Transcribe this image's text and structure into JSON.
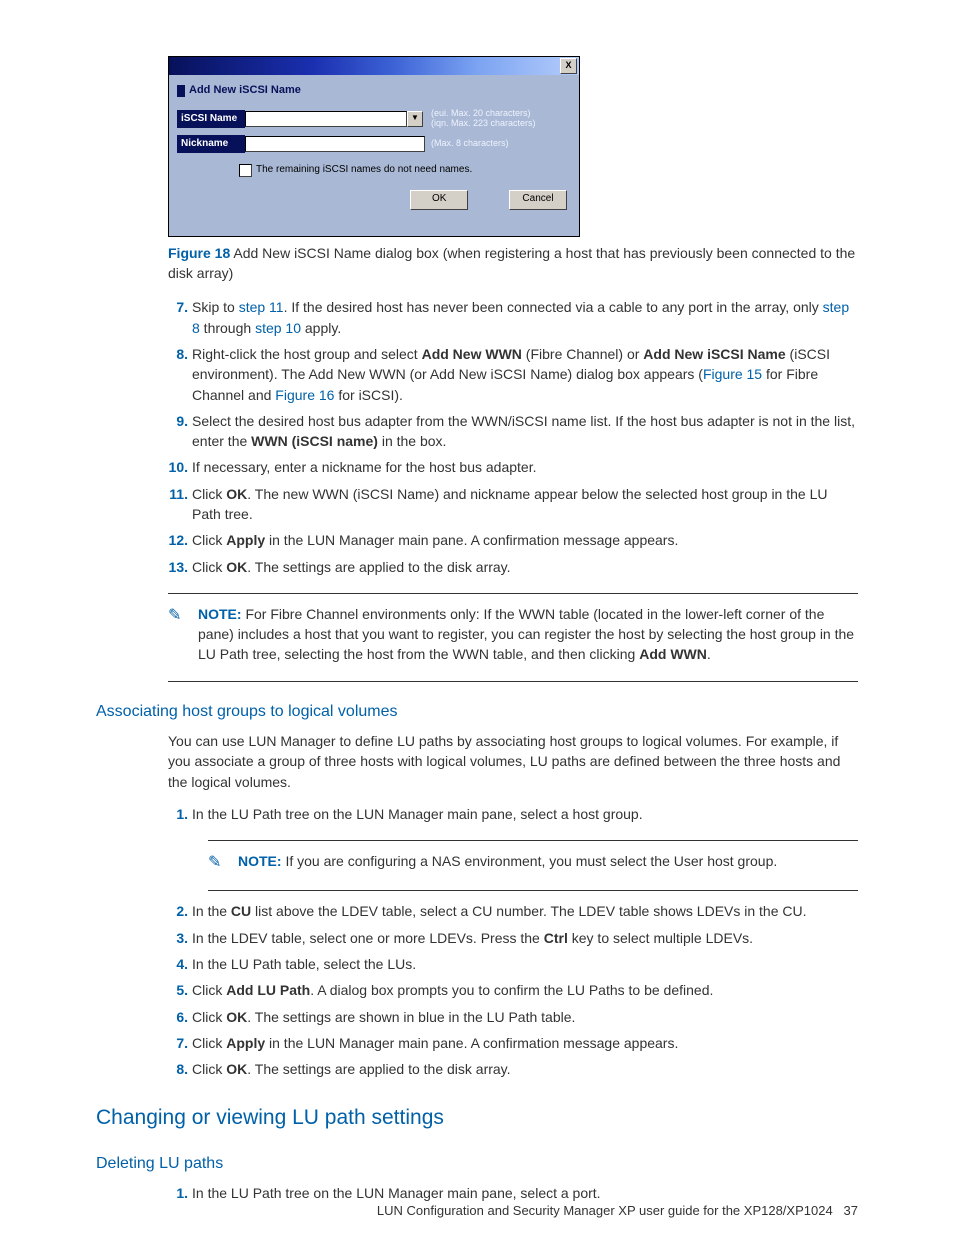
{
  "dialog": {
    "heading": "Add New iSCSI Name",
    "row1_label": "iSCSI Name",
    "row1_hint1": "(eui. Max. 20 characters)",
    "row1_hint2": "(iqn. Max. 223 characters)",
    "row2_label": "Nickname",
    "row2_hint": "(Max. 8 characters)",
    "checkbox": "The remaining iSCSI names do not need names.",
    "ok": "OK",
    "cancel": "Cancel",
    "close": "X",
    "dd": "▼"
  },
  "figure": {
    "num": "Figure 18",
    "caption": " Add New iSCSI Name dialog box (when registering a host that has previously been connected to the disk array)"
  },
  "steps_a": [
    {
      "n": "7.",
      "parts": [
        {
          "t": "Skip to "
        },
        {
          "t": "step 11",
          "l": 1
        },
        {
          "t": ". If the desired host has never been connected via a cable to any port in the array, only "
        },
        {
          "t": "step 8",
          "l": 1
        },
        {
          "t": " through "
        },
        {
          "t": "step 10",
          "l": 1
        },
        {
          "t": " apply."
        }
      ]
    },
    {
      "n": "8.",
      "parts": [
        {
          "t": "Right-click the host group and select "
        },
        {
          "t": "Add New WWN",
          "b": 1
        },
        {
          "t": " (Fibre Channel) or "
        },
        {
          "t": "Add New iSCSI Name",
          "b": 1
        },
        {
          "t": " (iSCSI environment). The Add New WWN (or Add New iSCSI Name) dialog box appears ("
        },
        {
          "t": "Figure 15",
          "l": 1
        },
        {
          "t": " for Fibre Channel and "
        },
        {
          "t": "Figure 16",
          "l": 1
        },
        {
          "t": " for iSCSI)."
        }
      ]
    },
    {
      "n": "9.",
      "parts": [
        {
          "t": "Select the desired host bus adapter from the WWN/iSCSI name list. If the host bus adapter is not in the list, enter the "
        },
        {
          "t": "WWN (iSCSI name)",
          "b": 1
        },
        {
          "t": " in the box."
        }
      ]
    },
    {
      "n": "10.",
      "parts": [
        {
          "t": "If necessary, enter a nickname for the host bus adapter."
        }
      ]
    },
    {
      "n": "11.",
      "parts": [
        {
          "t": "Click "
        },
        {
          "t": "OK",
          "b": 1
        },
        {
          "t": ". The new WWN (iSCSI Name) and nickname appear below the selected host group in the LU Path tree."
        }
      ]
    },
    {
      "n": "12.",
      "parts": [
        {
          "t": "Click "
        },
        {
          "t": "Apply",
          "b": 1
        },
        {
          "t": " in the LUN Manager main pane. A confirmation message appears."
        }
      ]
    },
    {
      "n": "13.",
      "parts": [
        {
          "t": "Click "
        },
        {
          "t": "OK",
          "b": 1
        },
        {
          "t": ". The settings are applied to the disk array."
        }
      ]
    }
  ],
  "note1": {
    "label": "NOTE:",
    "parts": [
      {
        "t": "   For Fibre Channel environments only: If the WWN table (located in the lower-left corner of the pane) includes a host that you want to register, you can register the host by selecting the host group in the LU Path tree, selecting the host from the WWN table, and then clicking "
      },
      {
        "t": "Add WWN",
        "b": 1
      },
      {
        "t": "."
      }
    ]
  },
  "h3_assoc": "Associating host groups to logical volumes",
  "para_assoc": "You can use LUN Manager to define LU paths by associating host groups to logical volumes. For example, if you associate a group of three hosts with logical volumes, LU paths are defined between the three hosts and the logical volumes.",
  "steps_b_pre": [
    {
      "n": "1.",
      "parts": [
        {
          "t": "In the LU Path tree on the LUN Manager main pane, select a host group."
        }
      ]
    }
  ],
  "note2": {
    "label": "NOTE:",
    "text": "   If you are configuring a NAS environment, you must select the User host group."
  },
  "steps_b_post": [
    {
      "n": "2.",
      "parts": [
        {
          "t": "In the "
        },
        {
          "t": "CU",
          "b": 1
        },
        {
          "t": " list above the LDEV table, select a CU number. The LDEV table shows LDEVs in the CU."
        }
      ]
    },
    {
      "n": "3.",
      "parts": [
        {
          "t": "In the LDEV table, select one or more LDEVs. Press the "
        },
        {
          "t": "Ctrl",
          "b": 1
        },
        {
          "t": " key to select multiple LDEVs."
        }
      ]
    },
    {
      "n": "4.",
      "parts": [
        {
          "t": "In the LU Path table, select the LUs."
        }
      ]
    },
    {
      "n": "5.",
      "parts": [
        {
          "t": "Click "
        },
        {
          "t": "Add LU Path",
          "b": 1
        },
        {
          "t": ". A dialog box prompts you to confirm the LU Paths to be defined."
        }
      ]
    },
    {
      "n": "6.",
      "parts": [
        {
          "t": "Click "
        },
        {
          "t": "OK",
          "b": 1
        },
        {
          "t": ". The settings are shown in blue in the LU Path table."
        }
      ]
    },
    {
      "n": "7.",
      "parts": [
        {
          "t": "Click "
        },
        {
          "t": "Apply",
          "b": 1
        },
        {
          "t": " in the LUN Manager main pane. A confirmation message appears."
        }
      ]
    },
    {
      "n": "8.",
      "parts": [
        {
          "t": "Click "
        },
        {
          "t": "OK",
          "b": 1
        },
        {
          "t": ". The settings are applied to the disk array."
        }
      ]
    }
  ],
  "h2_change": "Changing or viewing LU path settings",
  "h3_delete": "Deleting LU paths",
  "steps_c": [
    {
      "n": "1.",
      "parts": [
        {
          "t": "In the LU Path tree on the LUN Manager main pane, select a port."
        }
      ]
    }
  ],
  "footer": {
    "text": "LUN Configuration and Security Manager XP user guide for the XP128/XP1024",
    "page": "37"
  }
}
